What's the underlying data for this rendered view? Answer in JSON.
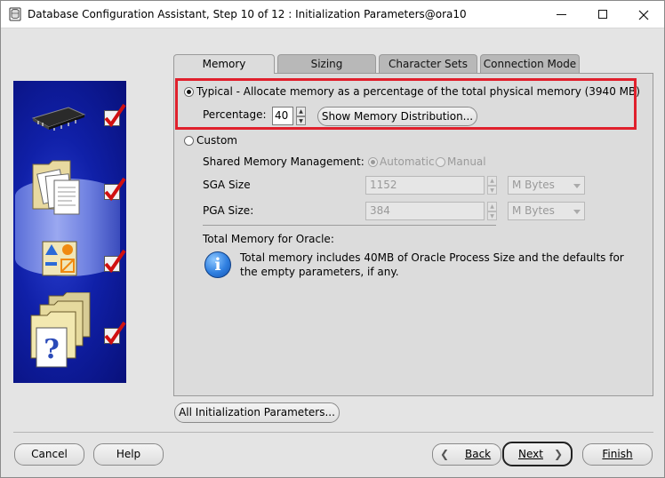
{
  "window": {
    "title": "Database Configuration Assistant, Step 10 of 12 : Initialization Parameters@ora10",
    "minimize_label": "—",
    "maximize_label": "☐",
    "close_label": "✕"
  },
  "tabs": [
    {
      "label": "Memory",
      "active": true
    },
    {
      "label": "Sizing",
      "active": false
    },
    {
      "label": "Character Sets",
      "active": false
    },
    {
      "label": "Connection Mode",
      "active": false
    }
  ],
  "memory": {
    "typical_label": "Typical - Allocate memory as a percentage of the total physical memory (3940 MB)",
    "typical_selected": true,
    "percentage_label": "Percentage:",
    "percentage_value": "40",
    "show_distribution_button": "Show Memory Distribution...",
    "custom_label": "Custom",
    "custom_selected": false,
    "shared_memory_label": "Shared Memory Management:",
    "automatic_label": "Automatic",
    "manual_label": "Manual",
    "sga_label": "SGA Size",
    "sga_value": "1152",
    "sga_unit": "M Bytes",
    "pga_label": "PGA Size:",
    "pga_value": "384",
    "pga_unit": "M Bytes",
    "total_memory_label": "Total Memory for Oracle:",
    "info_text": "Total memory includes 40MB of Oracle Process Size and the defaults for the empty parameters, if any."
  },
  "all_params_button": "All Initialization Parameters...",
  "footer": {
    "cancel": "Cancel",
    "help": "Help",
    "back": "Back",
    "next": "Next",
    "finish": "Finish"
  },
  "colors": {
    "highlight": "#e0202c",
    "side_panel": "#1020a8"
  },
  "steps_completed": 4
}
